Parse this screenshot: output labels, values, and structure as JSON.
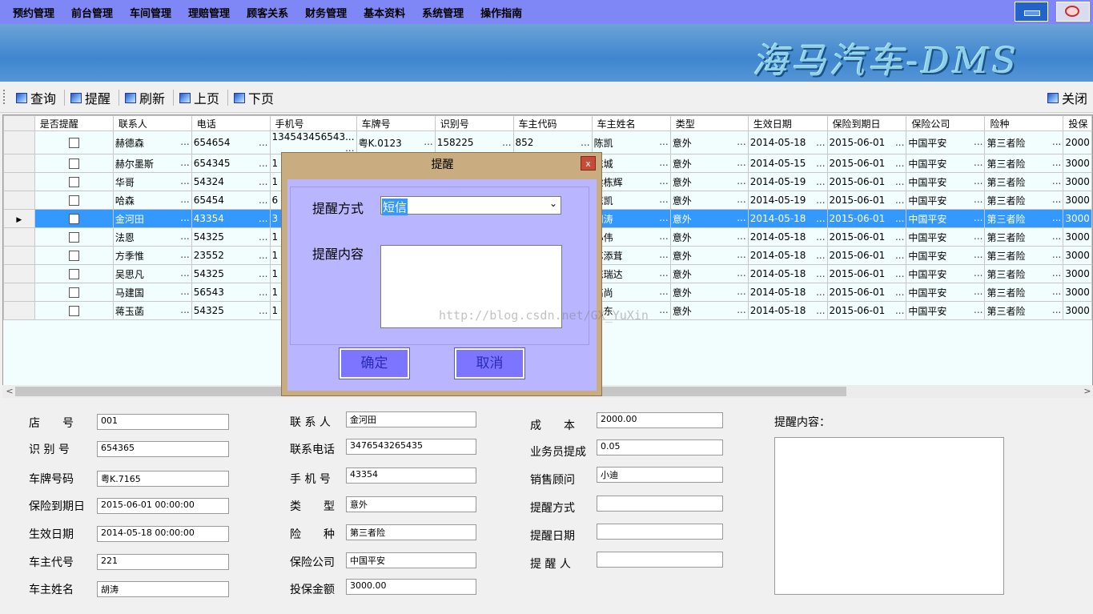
{
  "menu": [
    "预约管理",
    "前台管理",
    "车间管理",
    "理赔管理",
    "顾客关系",
    "财务管理",
    "基本资料",
    "系统管理",
    "操作指南"
  ],
  "banner_title": "海马汽车-DMS",
  "toolbar": {
    "query": "查询",
    "remind": "提醒",
    "refresh": "刷新",
    "prev": "上页",
    "next": "下页",
    "close": "关闭"
  },
  "grid": {
    "columns": [
      "是否提醒",
      "联系人",
      "电话",
      "手机号",
      "车牌号",
      "识别号",
      "车主代码",
      "车主姓名",
      "类型",
      "生效日期",
      "保险到期日",
      "保险公司",
      "险种",
      "投保"
    ],
    "rows": [
      [
        "赫德森",
        "654654",
        "134543456543...",
        "粤K.0123",
        "158225",
        "852",
        "陈凯",
        "意外",
        "2014-05-18",
        "2015-06-01",
        "中国平安",
        "第三者险",
        "2000"
      ],
      [
        "赫尔墨斯",
        "654345",
        "1",
        "",
        "",
        "",
        "陈城",
        "意外",
        "2014-05-15",
        "2015-06-01",
        "中国平安",
        "第三者险",
        "3000"
      ],
      [
        "华哥",
        "54324",
        "1",
        "",
        "",
        "",
        "梁栋辉",
        "意外",
        "2014-05-19",
        "2015-06-01",
        "中国平安",
        "第三者险",
        "3000"
      ],
      [
        "哈森",
        "65454",
        "6",
        "",
        "",
        "",
        "陈凯",
        "意外",
        "2014-05-19",
        "2015-06-01",
        "中国平安",
        "第三者险",
        "3000"
      ],
      [
        "金河田",
        "43354",
        "3",
        "",
        "",
        "",
        "胡涛",
        "意外",
        "2014-05-18",
        "2015-06-01",
        "中国平安",
        "第三者险",
        "3000"
      ],
      [
        "法恩",
        "54325",
        "1",
        "",
        "",
        "",
        "小伟",
        "意外",
        "2014-05-18",
        "2015-06-01",
        "中国平安",
        "第三者险",
        "3000"
      ],
      [
        "方季惟",
        "23552",
        "1",
        "",
        "",
        "",
        "苏添茸",
        "意外",
        "2014-05-18",
        "2015-06-01",
        "中国平安",
        "第三者险",
        "3000"
      ],
      [
        "吴思凡",
        "54325",
        "1",
        "",
        "",
        "",
        "陈瑞达",
        "意外",
        "2014-05-18",
        "2015-06-01",
        "中国平安",
        "第三者险",
        "3000"
      ],
      [
        "马建国",
        "56543",
        "1",
        "",
        "",
        "",
        "高尚",
        "意外",
        "2014-05-18",
        "2015-06-01",
        "中国平安",
        "第三者险",
        "3000"
      ],
      [
        "蒋玉菡",
        "54325",
        "1",
        "",
        "",
        "",
        "卫东",
        "意外",
        "2014-05-18",
        "2015-06-01",
        "中国平安",
        "第三者险",
        "3000"
      ]
    ],
    "selected_row": 4
  },
  "dialog": {
    "title": "提醒",
    "close": "x",
    "method_label": "提醒方式",
    "method_value": "短信",
    "content_label": "提醒内容",
    "ok": "确定",
    "cancel": "取消"
  },
  "watermark": "http://blog.csdn.net/GX_YuXin",
  "form": {
    "col1": [
      {
        "label": "店　　号",
        "value": "001"
      },
      {
        "label": "识 别 号",
        "value": "654365"
      },
      {
        "label": "车牌号码",
        "value": "粤K.7165"
      },
      {
        "label": "保险到期日",
        "value": "2015-06-01 00:00:00"
      },
      {
        "label": "生效日期",
        "value": "2014-05-18 00:00:00"
      },
      {
        "label": "车主代号",
        "value": "221"
      },
      {
        "label": "车主姓名",
        "value": "胡涛"
      }
    ],
    "col2": [
      {
        "label": "联 系 人",
        "value": "金河田"
      },
      {
        "label": "联系电话",
        "value": "3476543265435"
      },
      {
        "label": "手 机 号",
        "value": "43354"
      },
      {
        "label": "类　　型",
        "value": "意外"
      },
      {
        "label": "险　　种",
        "value": "第三者险"
      },
      {
        "label": "保险公司",
        "value": "中国平安"
      },
      {
        "label": "投保金额",
        "value": "3000.00"
      }
    ],
    "col3": [
      {
        "label": "成　　本",
        "value": "2000.00"
      },
      {
        "label": "业务员提成",
        "value": "0.05"
      },
      {
        "label": "销售顾问",
        "value": "小迪"
      },
      {
        "label": "提醒方式",
        "value": ""
      },
      {
        "label": "提醒日期",
        "value": ""
      },
      {
        "label": "提 醒 人",
        "value": ""
      }
    ],
    "note_label": "提醒内容："
  }
}
